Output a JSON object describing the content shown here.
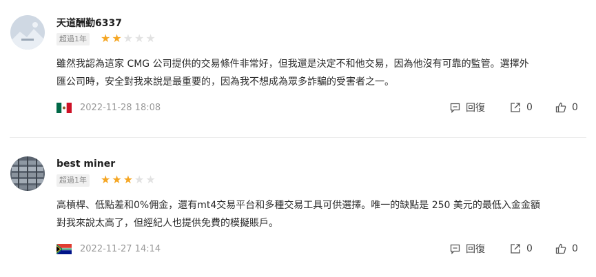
{
  "reviews": [
    {
      "username": "天道酬勤6337",
      "badge": "超過1年",
      "rating": 2,
      "max_rating": 5,
      "text_line1": "雖然我認為這家 CMG 公司提供的交易條件非常好，但我還是決定不和他交易，因為他沒有可靠的監管。選擇外",
      "text_line2": "匯公司時，安全對我來說是最重要的，因為我不想成為眾多詐騙的受害者之一。",
      "flag": "mexico-flag",
      "date": "2022-11-28 18:08",
      "reply_label": "回復",
      "share_count": "0",
      "like_count": "0"
    },
    {
      "username": "best miner",
      "badge": "超過1年",
      "rating": 3,
      "max_rating": 5,
      "text_line1": "高槓桿、低點差和0%佣金，還有mt4交易平台和多種交易工具可供選擇。唯一的缺點是 250 美元的最低入金金額",
      "text_line2": "對我來說太高了，但經紀人也提供免費的模擬賬戶。",
      "flag": "south-africa-flag",
      "date": "2022-11-27 14:14",
      "reply_label": "回復",
      "share_count": "0",
      "like_count": "0"
    }
  ],
  "colors": {
    "star_on": "#f5a623",
    "star_off": "#e2e2e2"
  }
}
